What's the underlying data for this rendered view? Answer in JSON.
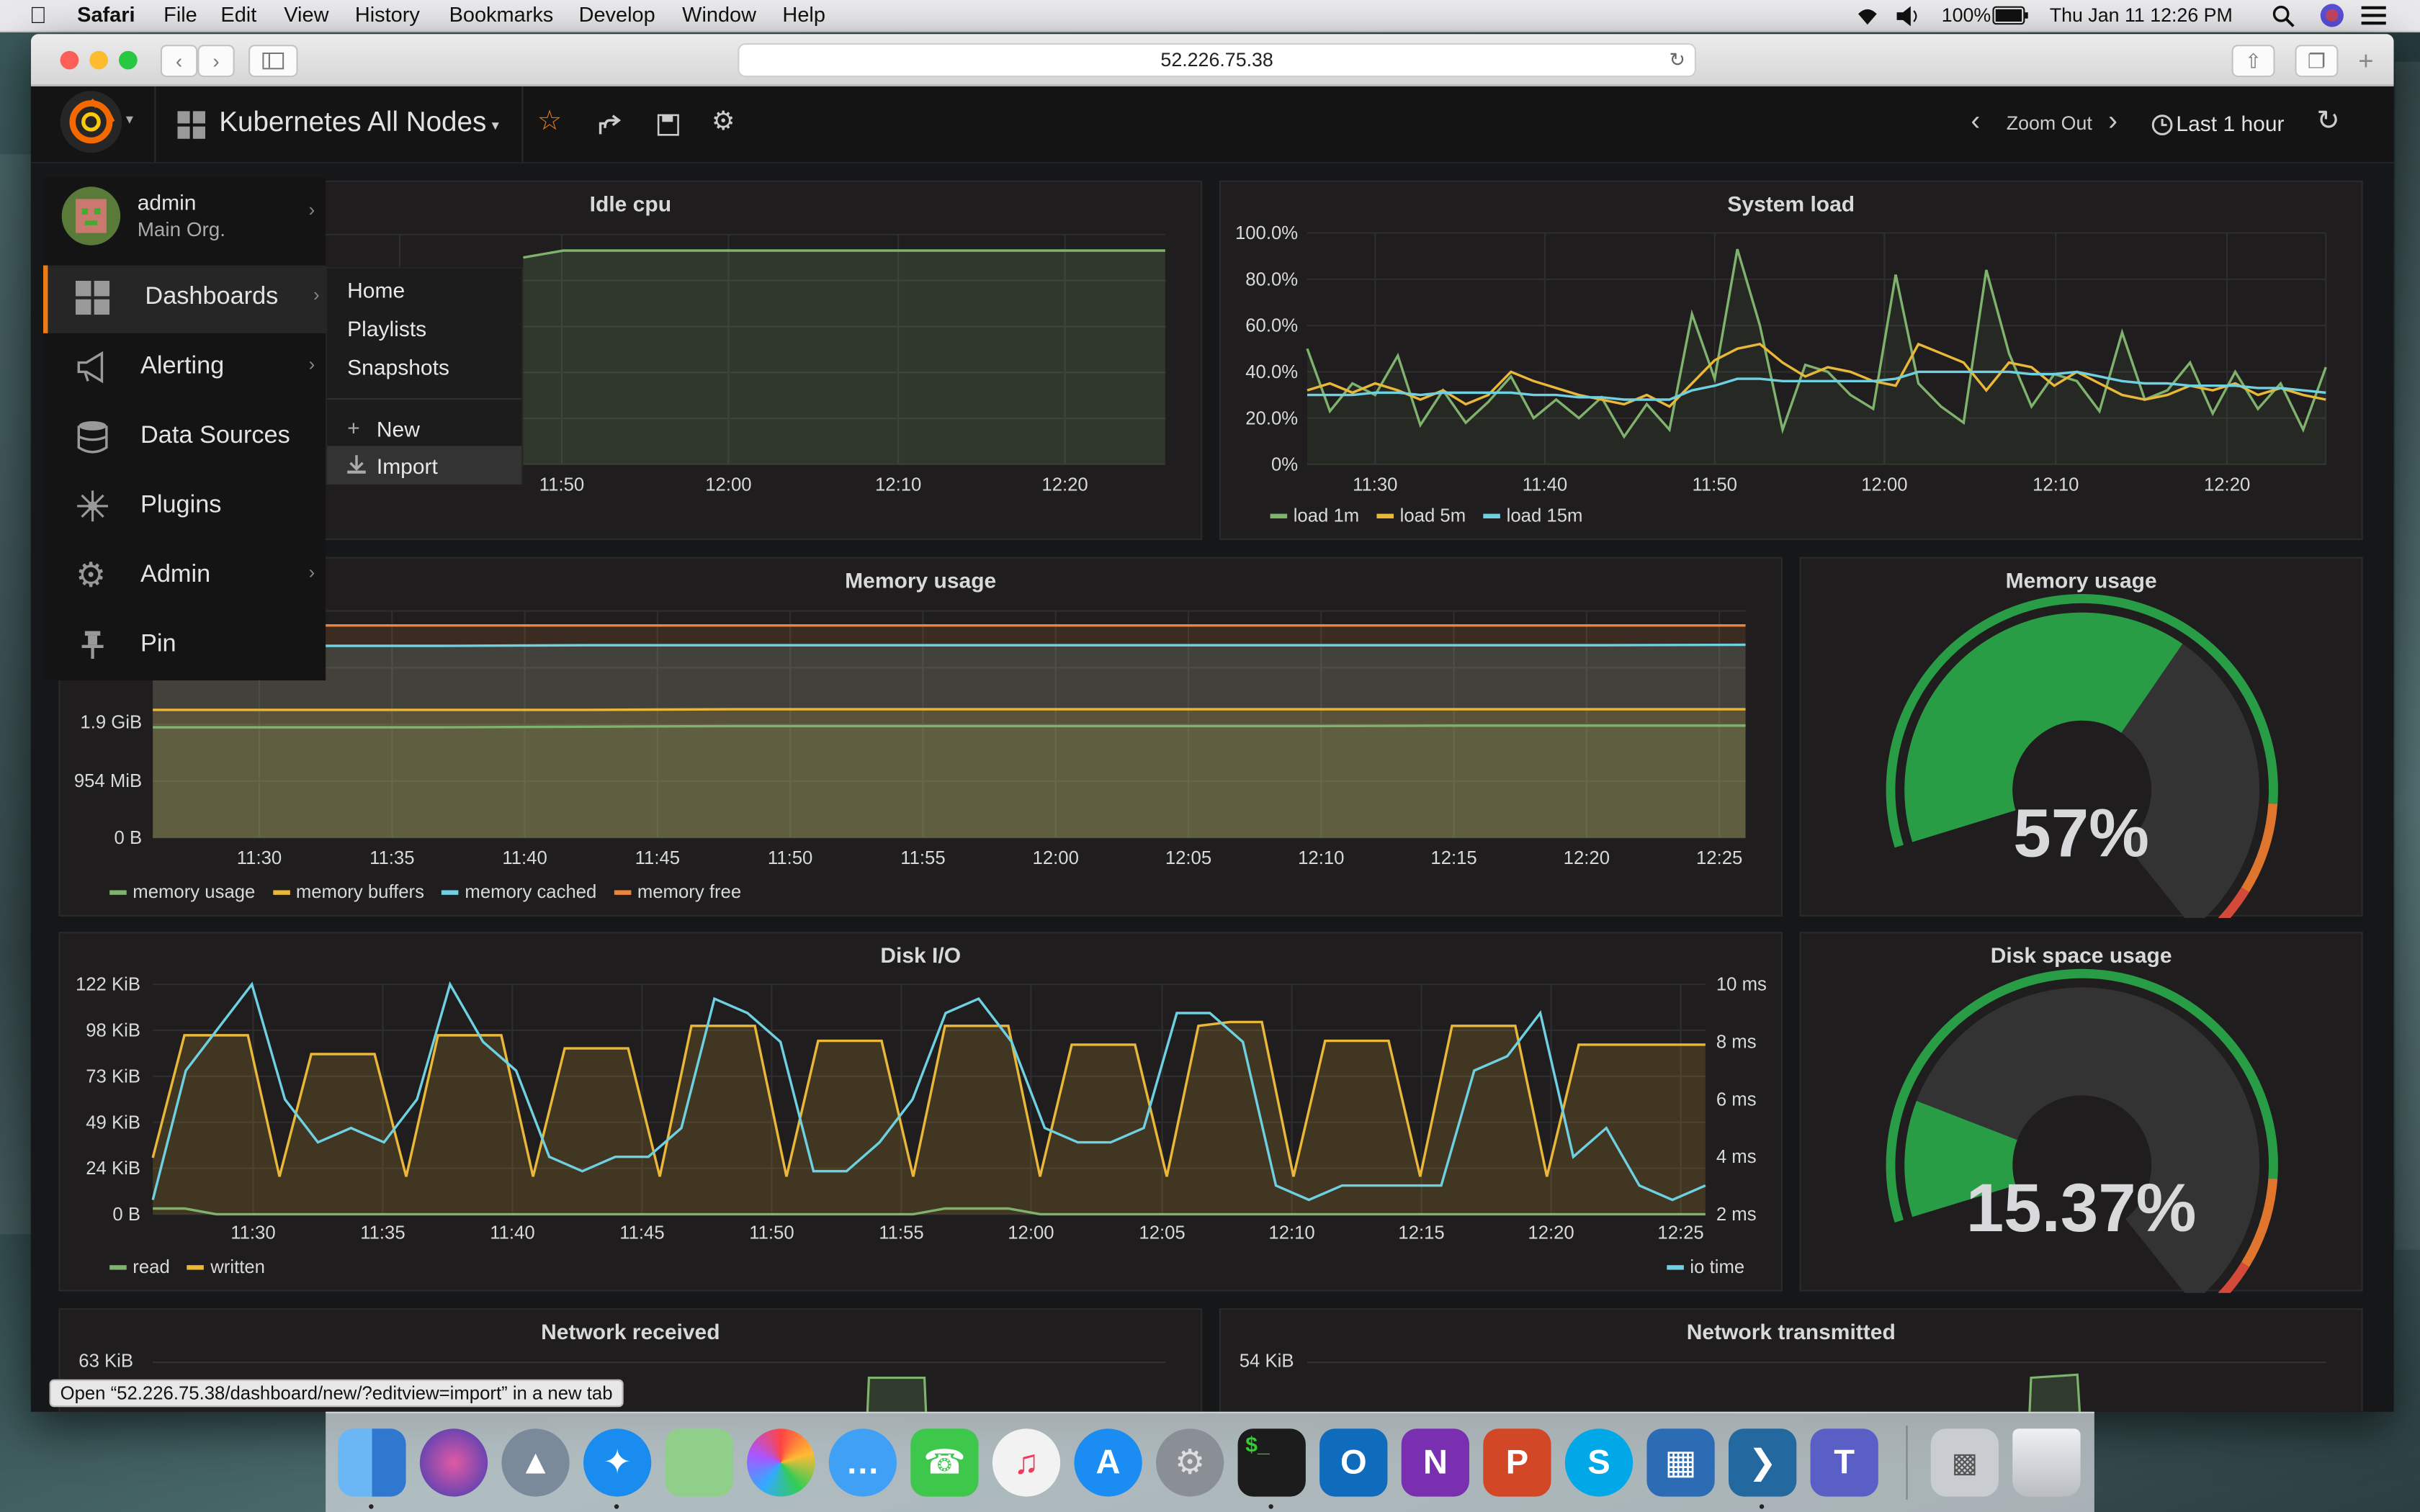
{
  "mac_menubar": {
    "app_name": "Safari",
    "menus": [
      "File",
      "Edit",
      "View",
      "History",
      "Bookmarks",
      "Develop",
      "Window",
      "Help"
    ],
    "battery": "100%",
    "clock": "Thu Jan 11  12:26 PM"
  },
  "browser": {
    "url": "52.226.75.38",
    "status_text": "Open “52.226.75.38/dashboard/new/?editview=import” in a new tab"
  },
  "grafana_nav": {
    "dashboard_title": "Kubernetes All Nodes",
    "zoom_out_label": "Zoom Out",
    "time_range": "Last 1 hour"
  },
  "side_menu": {
    "user_name": "admin",
    "org_name": "Main Org.",
    "items": [
      {
        "label": "Dashboards",
        "icon": "dashboards-icon"
      },
      {
        "label": "Alerting",
        "icon": "alert-megaphone-icon"
      },
      {
        "label": "Data Sources",
        "icon": "database-icon"
      },
      {
        "label": "Plugins",
        "icon": "plugins-icon"
      },
      {
        "label": "Admin",
        "icon": "gears-icon"
      },
      {
        "label": "Pin",
        "icon": "pin-icon"
      }
    ],
    "submenu": [
      "Home",
      "Playlists",
      "Snapshots",
      "New",
      "Import"
    ]
  },
  "panels": {
    "idle_cpu": {
      "title": "Idle cpu"
    },
    "system_load": {
      "title": "System load"
    },
    "memory_usage_graph": {
      "title": "Memory usage"
    },
    "memory_usage_gauge": {
      "title": "Memory usage",
      "value_text": "57%"
    },
    "disk_io": {
      "title": "Disk I/O"
    },
    "disk_space_gauge": {
      "title": "Disk space usage",
      "value_text": "15.37%"
    },
    "network_received": {
      "title": "Network received",
      "y_top": "63 KiB"
    },
    "network_transmitted": {
      "title": "Network transmitted",
      "y_top": "54 KiB"
    }
  },
  "chart_data": [
    {
      "id": "idle_cpu",
      "type": "area",
      "title": "Idle cpu",
      "x": [
        "11:50",
        "12:00",
        "12:10",
        "12:20"
      ],
      "series": [
        {
          "name": "",
          "values": [
            0.9,
            0.93,
            0.93,
            0.93,
            0.93,
            0.93,
            0.93,
            0.93,
            0.93,
            0.93,
            0.93,
            0.93,
            0.93,
            0.93,
            0.93,
            0.93,
            0.93
          ],
          "color": "#7eb26d"
        }
      ]
    },
    {
      "id": "system_load",
      "type": "line",
      "title": "System load",
      "x": [
        "11:30",
        "11:40",
        "11:50",
        "12:00",
        "12:10",
        "12:20"
      ],
      "y_ticks": [
        "100.0%",
        "80.0%",
        "60.0%",
        "40.0%",
        "20.0%",
        "0%"
      ],
      "ylim": [
        0,
        100
      ],
      "series": [
        {
          "name": "load 1m",
          "color": "#7eb26d",
          "values": [
            50,
            23,
            35,
            30,
            47,
            17,
            32,
            18,
            27,
            38,
            20,
            28,
            20,
            29,
            12,
            26,
            15,
            65,
            37,
            93,
            60,
            15,
            43,
            40,
            30,
            24,
            82,
            35,
            25,
            18,
            84,
            48,
            25,
            39,
            36,
            23,
            57,
            28,
            32,
            44,
            22,
            40,
            24,
            35,
            15,
            42
          ]
        },
        {
          "name": "load 5m",
          "color": "#eab839",
          "values": [
            32,
            35,
            31,
            35,
            32,
            28,
            32,
            26,
            30,
            40,
            36,
            33,
            30,
            28,
            26,
            30,
            25,
            35,
            45,
            50,
            52,
            44,
            38,
            42,
            40,
            36,
            34,
            52,
            48,
            44,
            32,
            44,
            42,
            34,
            40,
            35,
            30,
            28,
            30,
            34,
            32,
            35,
            30,
            33,
            30,
            28
          ]
        },
        {
          "name": "load 15m",
          "color": "#6ed0e0",
          "values": [
            30,
            30,
            30,
            31,
            31,
            30,
            31,
            31,
            31,
            31,
            30,
            30,
            29,
            29,
            28,
            28,
            28,
            32,
            34,
            37,
            37,
            36,
            36,
            36,
            36,
            36,
            37,
            40,
            40,
            40,
            40,
            40,
            39,
            39,
            40,
            38,
            36,
            35,
            35,
            34,
            34,
            34,
            33,
            33,
            32,
            31
          ]
        }
      ]
    },
    {
      "id": "memory_usage_graph",
      "type": "area",
      "title": "Memory usage",
      "x": [
        "11:30",
        "11:35",
        "11:40",
        "11:45",
        "11:50",
        "11:55",
        "12:00",
        "12:05",
        "12:10",
        "12:15",
        "12:20",
        "12:25"
      ],
      "y_ticks": [
        "1.9 GiB",
        "954 MiB",
        "0 B"
      ],
      "series": [
        {
          "name": "memory usage",
          "color": "#7eb26d",
          "values_gib": [
            1.9,
            1.9,
            1.9,
            1.91,
            1.92,
            1.92,
            1.92,
            1.92,
            1.92,
            1.93,
            1.93,
            1.93
          ]
        },
        {
          "name": "memory buffers",
          "color": "#eab839",
          "values_gib": [
            2.2,
            2.2,
            2.2,
            2.2,
            2.21,
            2.21,
            2.21,
            2.21,
            2.21,
            2.21,
            2.21,
            2.21
          ]
        },
        {
          "name": "memory cached",
          "color": "#6ed0e0",
          "values_gib": [
            3.3,
            3.3,
            3.3,
            3.31,
            3.31,
            3.31,
            3.31,
            3.31,
            3.31,
            3.31,
            3.31,
            3.32
          ]
        },
        {
          "name": "memory free",
          "color": "#ef843c",
          "values_gib": [
            3.65,
            3.65,
            3.65,
            3.65,
            3.65,
            3.65,
            3.65,
            3.65,
            3.65,
            3.65,
            3.65,
            3.65
          ]
        }
      ]
    },
    {
      "id": "disk_io",
      "type": "area",
      "title": "Disk I/O",
      "x": [
        "11:30",
        "11:35",
        "11:40",
        "11:45",
        "11:50",
        "11:55",
        "12:00",
        "12:05",
        "12:10",
        "12:15",
        "12:20",
        "12:25"
      ],
      "y_ticks_left": [
        "122 KiB",
        "98 KiB",
        "73 KiB",
        "49 KiB",
        "24 KiB",
        "0 B"
      ],
      "y_ticks_right": [
        "10 ms",
        "8 ms",
        "6 ms",
        "4 ms",
        "2 ms"
      ],
      "series": [
        {
          "name": "read",
          "color": "#7eb26d",
          "axis": "left",
          "values": [
            3,
            3,
            0,
            0,
            0,
            0,
            0,
            0,
            0,
            0,
            0,
            0,
            0,
            0,
            0,
            0,
            0,
            0,
            0,
            0,
            0,
            0,
            0,
            0,
            0,
            3,
            3,
            3,
            0,
            0,
            0,
            0,
            0,
            0,
            0,
            0,
            0,
            0,
            0,
            0,
            0,
            0,
            0,
            0,
            0,
            0,
            0,
            0,
            0,
            0
          ]
        },
        {
          "name": "written",
          "color": "#eab839",
          "axis": "left",
          "values": [
            30,
            95,
            95,
            95,
            20,
            85,
            85,
            85,
            20,
            95,
            95,
            95,
            20,
            88,
            88,
            88,
            20,
            100,
            100,
            100,
            20,
            92,
            92,
            92,
            20,
            100,
            100,
            100,
            20,
            90,
            90,
            90,
            20,
            100,
            102,
            102,
            20,
            92,
            92,
            92,
            20,
            100,
            100,
            100,
            20,
            90,
            90,
            90,
            90,
            90
          ]
        },
        {
          "name": "io time",
          "color": "#6ed0e0",
          "axis": "right",
          "values": [
            2.5,
            7,
            8.5,
            10,
            6,
            4.5,
            5,
            4.5,
            6,
            10,
            8,
            7,
            4,
            3.5,
            4,
            4,
            5,
            9.5,
            9,
            8,
            3.5,
            3.5,
            4.5,
            6,
            9,
            9.5,
            8,
            5,
            4.5,
            4.5,
            5,
            9,
            9,
            8,
            3,
            2.5,
            3,
            3,
            3,
            3,
            7,
            7.5,
            9,
            4,
            5,
            3,
            2.5,
            3
          ]
        }
      ]
    },
    {
      "id": "memory_usage_gauge",
      "type": "gauge",
      "value": 57,
      "unit": "%"
    },
    {
      "id": "disk_space_gauge",
      "type": "gauge",
      "value": 15.37,
      "unit": "%"
    }
  ]
}
